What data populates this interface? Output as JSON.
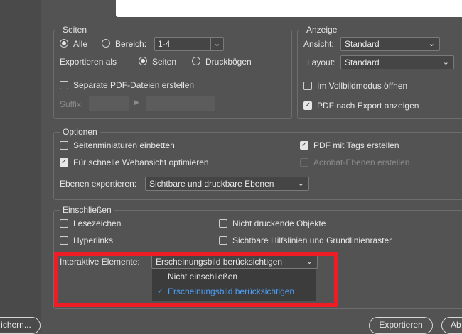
{
  "pages": {
    "title": "Seiten",
    "all_label": "Alle",
    "range_label": "Bereich:",
    "range_value": "1-4",
    "export_as_label": "Exportieren als",
    "pages_option": "Seiten",
    "spreads_option": "Druckbögen",
    "separate_pdf_label": "Separate PDF-Dateien erstellen",
    "suffix_label": "Suffix:"
  },
  "view": {
    "title": "Anzeige",
    "view_label": "Ansicht:",
    "view_value": "Standard",
    "layout_label": "Layout:",
    "layout_value": "Standard",
    "fullscreen_label": "Im Vollbildmodus öffnen",
    "show_after_export_label": "PDF nach Export anzeigen"
  },
  "options": {
    "title": "Optionen",
    "embed_thumbnails_label": "Seitenminiaturen einbetten",
    "web_optimize_label": "Für schnelle Webansicht optimieren",
    "tagged_pdf_label": "PDF mit Tags erstellen",
    "acrobat_layers_label": "Acrobat-Ebenen erstellen",
    "export_layers_label": "Ebenen exportieren:",
    "export_layers_value": "Sichtbare und druckbare Ebenen"
  },
  "include": {
    "title": "Einschließen",
    "bookmarks_label": "Lesezeichen",
    "hyperlinks_label": "Hyperlinks",
    "nonprinting_label": "Nicht druckende Objekte",
    "guides_label": "Sichtbare Hilfslinien und Grundlinienraster",
    "interactive_label": "Interaktive Elemente:",
    "interactive_value": "Erscheinungsbild berücksichtigen",
    "dropdown_options": [
      "Nicht einschließen",
      "Erscheinungsbild berücksichtigen"
    ],
    "checkmark": "✓"
  },
  "buttons": {
    "save_preset": "ichern...",
    "export": "Exportieren",
    "cancel": "Ab"
  },
  "colors": {
    "highlight": "#ee1c24",
    "selected_option": "#4d9ef5"
  }
}
